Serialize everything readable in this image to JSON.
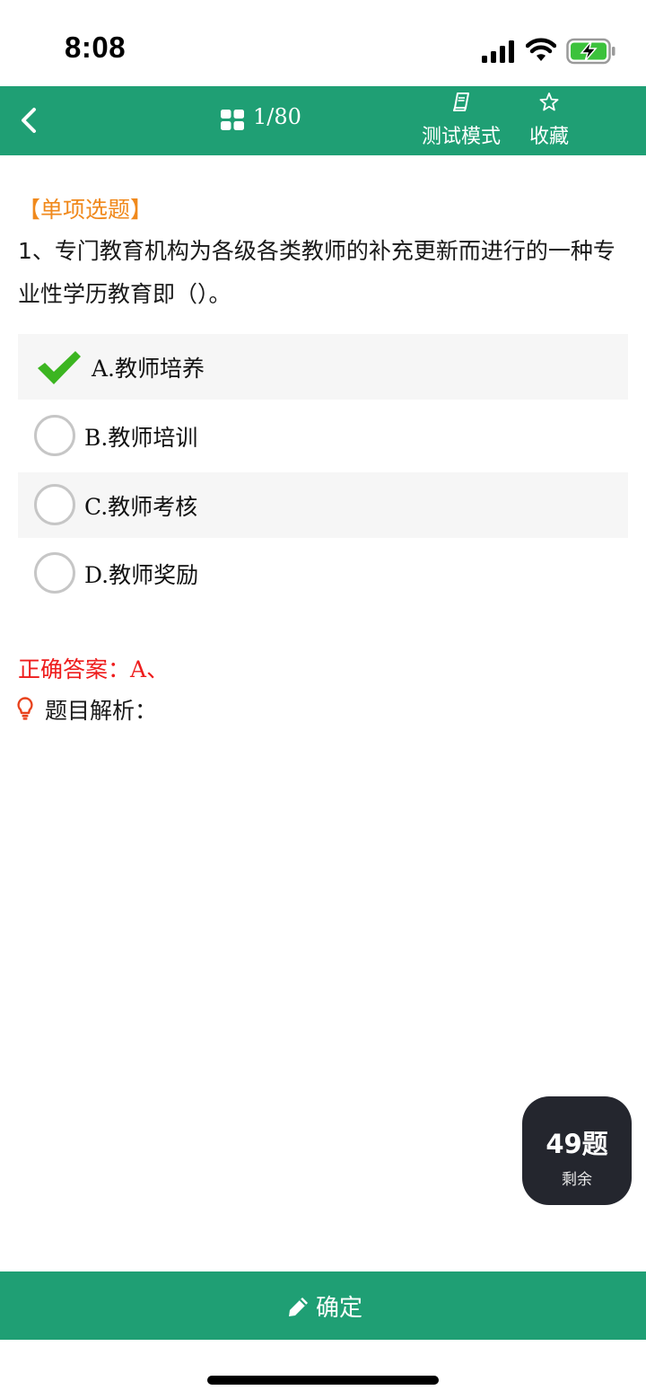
{
  "status_bar": {
    "time": "8:08"
  },
  "nav": {
    "counter": "1/80",
    "test_mode_label": "测试模式",
    "favorite_label": "收藏"
  },
  "question": {
    "type": "【单项选题】",
    "text": "1、专门教育机构为各级各类教师的补充更新而进行的一种专业性学历教育即（）。",
    "options": [
      {
        "label": "A.教师培养",
        "selected": true
      },
      {
        "label": "B.教师培训",
        "selected": false
      },
      {
        "label": "C.教师考核",
        "selected": false
      },
      {
        "label": "D.教师奖励",
        "selected": false
      }
    ]
  },
  "answer": {
    "label": "正确答案：",
    "value": "A、"
  },
  "analysis": {
    "label": "题目解析："
  },
  "remaining": {
    "count": "49题",
    "label": "剩余"
  },
  "confirm": {
    "label": "确定"
  },
  "colors": {
    "brand_green": "#1f9f74",
    "question_type": "#f0891c",
    "answer_red": "#ee1c1c",
    "check_green": "#3cb521"
  },
  "icons": [
    "signal-icon",
    "wifi-icon",
    "battery-icon",
    "back-chevron-icon",
    "grid-icon",
    "book-icon",
    "star-icon",
    "checkmark-icon",
    "radio-icon",
    "bulb-icon",
    "pencil-icon"
  ]
}
